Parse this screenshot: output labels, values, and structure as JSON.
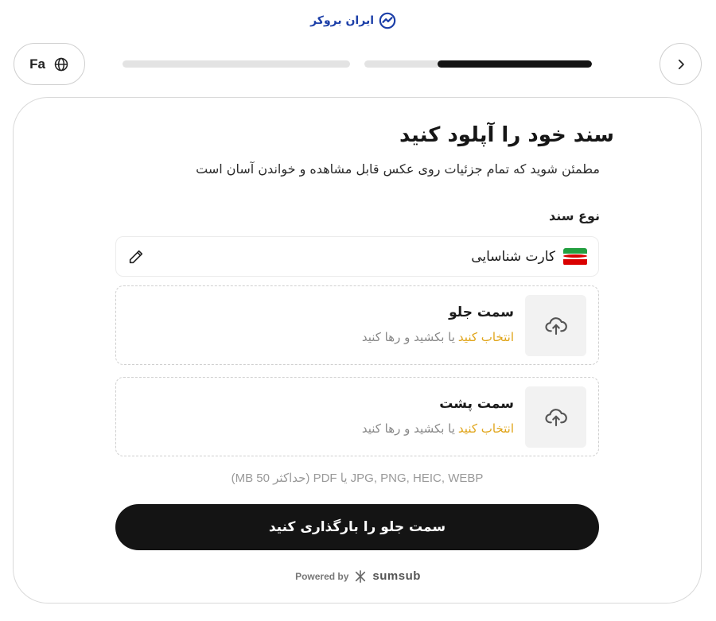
{
  "header": {
    "logo_text": "ایران بروکر",
    "language_label": "Fa",
    "progress": [
      {
        "fill": 0.0
      },
      {
        "fill": 0.68
      }
    ]
  },
  "page": {
    "title": "سند خود را آپلود کنید",
    "subtitle": "مطمئن شوید که تمام جزئیات روی عکس قابل مشاهده و خواندن آسان است",
    "document_type_label": "نوع سند",
    "document_type_value": "کارت شناسایی"
  },
  "uploads": [
    {
      "title": "سمت جلو",
      "hint_link": "انتخاب کنید",
      "hint_rest": "یا بکشید و رها کنید"
    },
    {
      "title": "سمت پشت",
      "hint_link": "انتخاب کنید",
      "hint_rest": "یا بکشید و رها کنید"
    }
  ],
  "formats_note": "JPG, PNG, HEIC, WEBP یا PDF (حداکثر 50 MB)",
  "primary_button": "سمت جلو را بارگذاری کنید",
  "footer": {
    "powered_by": "Powered by",
    "brand": "sumsub"
  },
  "colors": {
    "accent": "#e0a418",
    "primary": "#141414",
    "logo_blue": "#1c3fa8"
  },
  "icons": {
    "logo": "chart-check-icon",
    "language": "globe-icon",
    "nav": "chevron-right-icon",
    "edit": "pencil-icon",
    "upload": "cloud-upload-icon",
    "flag": "iran-flag-icon"
  }
}
